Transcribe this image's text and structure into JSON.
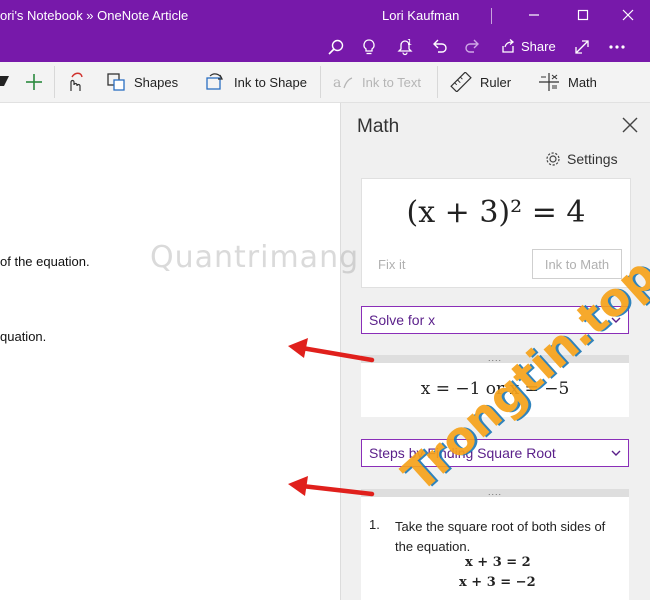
{
  "window": {
    "title": "ori's Notebook » OneNote Article",
    "user": "Lori Kaufman",
    "share_label": "Share"
  },
  "ribbon": {
    "shapes_label": "Shapes",
    "ink_to_shape_label": "Ink to Shape",
    "ink_to_text_label": "Ink to Text",
    "ruler_label": "Ruler",
    "math_label": "Math"
  },
  "page": {
    "line1": "of the equation.",
    "line2": "quation."
  },
  "math_pane": {
    "title": "Math",
    "settings_label": "Settings",
    "equation": "(x + 3)² = 4",
    "fix_it_label": "Fix it",
    "ink_to_math_label": "Ink to Math",
    "action_select": "Solve for x",
    "solution": "x = −1 or x = −5",
    "method_select": "Steps by Finding Square Root",
    "step1_number": "1.",
    "step1_text": "Take the square root of both sides of the equation.",
    "step1_eq1": "x + 3 = 2",
    "step1_eq2": "x + 3 = −2",
    "grip": "...."
  },
  "watermark": {
    "text1": "Quantrimang",
    "text2": "Trongtin.top"
  },
  "colors": {
    "titlebar": "#7719aa",
    "arrow": "#e0201c",
    "select_border": "#8a2eb8"
  }
}
